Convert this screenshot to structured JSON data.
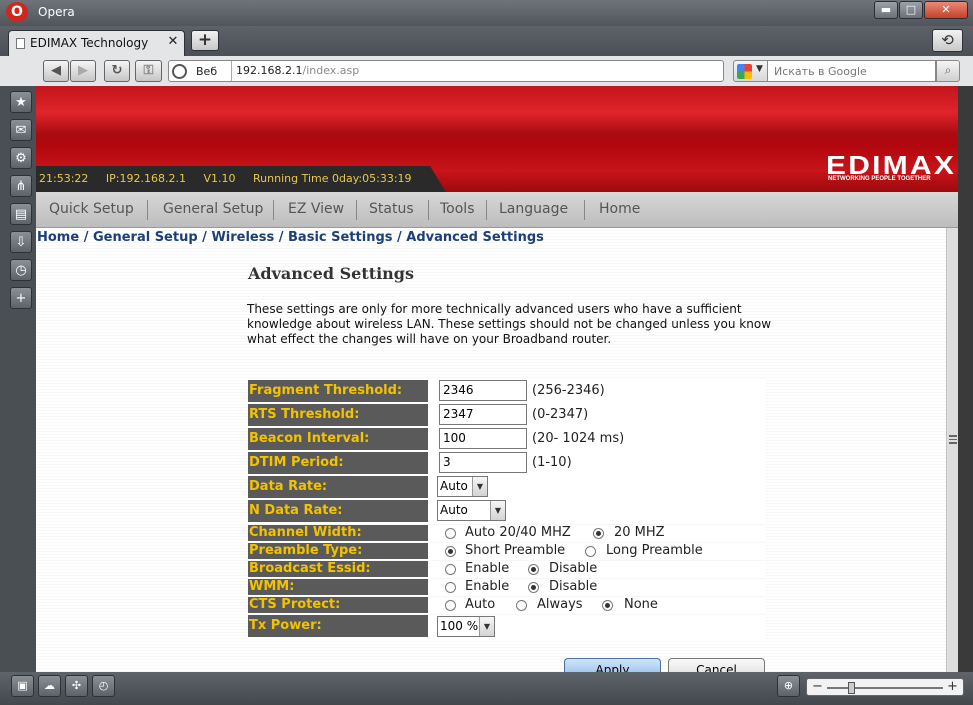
{
  "window": {
    "app_name": "Opera",
    "logo_letter": "O"
  },
  "tab": {
    "title": "EDIMAX Technology",
    "close": "✕",
    "new": "+",
    "restore": "⟲"
  },
  "address": {
    "mode": "Веб",
    "host": "192.168.2.1",
    "path": "/index.asp"
  },
  "search": {
    "placeholder": "Искать в Google"
  },
  "router": {
    "status": {
      "time": "21:53:22",
      "ip": "IP:192.168.2.1",
      "version": "V1.10",
      "running": "Running Time 0day:05:33:19"
    },
    "logo": "EDIMAX",
    "tagline": "NETWORKING PEOPLE TOGETHER",
    "menu": [
      "Quick Setup",
      "General Setup",
      "EZ View",
      "Status",
      "Tools",
      "Language",
      "Home"
    ],
    "breadcrumb": "Home / General Setup / Wireless / Basic Settings / Advanced Settings",
    "title": "Advanced Settings",
    "description": "These settings are only for more technically advanced users who have a sufficient knowledge about wireless LAN. These settings should not be changed unless you know what effect the changes will have on your Broadband router.",
    "fields": {
      "fragment": {
        "label": "Fragment Threshold:",
        "value": "2346",
        "range": "(256-2346)"
      },
      "rts": {
        "label": "RTS Threshold:",
        "value": "2347",
        "range": "(0-2347)"
      },
      "beacon": {
        "label": "Beacon Interval:",
        "value": "100",
        "range": "(20- 1024 ms)"
      },
      "dtim": {
        "label": "DTIM Period:",
        "value": "3",
        "range": "(1-10)"
      },
      "data_rate": {
        "label": "Data Rate:",
        "value": "Auto"
      },
      "n_data_rate": {
        "label": "N Data Rate:",
        "value": "Auto"
      },
      "channel_width": {
        "label": "Channel Width:",
        "options": [
          "Auto 20/40 MHZ",
          "20 MHZ"
        ],
        "selected": "20 MHZ"
      },
      "preamble": {
        "label": "Preamble Type:",
        "options": [
          "Short Preamble",
          "Long Preamble"
        ],
        "selected": "Short Preamble"
      },
      "broadcast": {
        "label": "Broadcast Essid:",
        "options": [
          "Enable",
          "Disable"
        ],
        "selected": "Disable"
      },
      "wmm": {
        "label": "WMM:",
        "options": [
          "Enable",
          "Disable"
        ],
        "selected": "Disable"
      },
      "cts": {
        "label": "CTS Protect:",
        "options": [
          "Auto",
          "Always",
          "None"
        ],
        "selected": "None"
      },
      "tx_power": {
        "label": "Tx Power:",
        "value": "100 %"
      }
    },
    "buttons": {
      "apply": "Apply",
      "cancel": "Cancel"
    }
  },
  "panel_icons": [
    "bookmarks-icon",
    "mail-icon",
    "settings-icon",
    "share-icon",
    "notes-icon",
    "downloads-icon",
    "history-icon",
    "add-panel-icon"
  ]
}
